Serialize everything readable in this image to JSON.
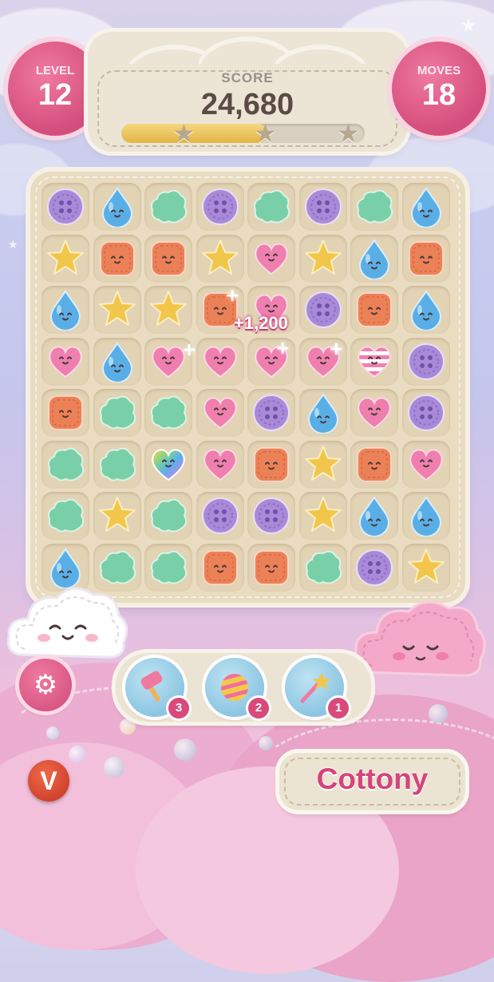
{
  "hud": {
    "level_label": "LEVEL",
    "level_value": "12",
    "score_label": "SCORE",
    "score_value": "24,680",
    "moves_label": "MOVES",
    "moves_value": "18",
    "score_progress": 0.6,
    "stars_total": 3
  },
  "board": {
    "rows": 8,
    "cols": 8,
    "grid": [
      [
        "button",
        "drop",
        "cloud",
        "button",
        "cloud",
        "button",
        "cloud",
        "drop"
      ],
      [
        "star",
        "square",
        "square",
        "star",
        "heart",
        "star",
        "drop",
        "square"
      ],
      [
        "drop",
        "star",
        "star",
        "square",
        "heart",
        "button",
        "square",
        "drop"
      ],
      [
        "heart",
        "drop",
        "heart",
        "heart",
        "heart",
        "heart",
        "striped-heart",
        "button"
      ],
      [
        "square",
        "cloud",
        "cloud",
        "heart",
        "button",
        "drop",
        "heart",
        "button"
      ],
      [
        "cloud",
        "cloud",
        "rainbow-heart",
        "heart",
        "square",
        "star",
        "square",
        "heart"
      ],
      [
        "cloud",
        "star",
        "cloud",
        "button",
        "button",
        "star",
        "drop",
        "drop"
      ],
      [
        "drop",
        "cloud",
        "cloud",
        "square",
        "square",
        "cloud",
        "button",
        "star"
      ]
    ],
    "score_popup": "+1,200"
  },
  "boosters": [
    {
      "name": "hammer",
      "count": "3"
    },
    {
      "name": "candy-ball",
      "count": "2"
    },
    {
      "name": "magic-wand",
      "count": "1"
    }
  ],
  "brand": {
    "name": "Cottony",
    "logo_letter": "V"
  },
  "colors": {
    "button": "#a88ad8",
    "drop": "#5aaee6",
    "cloud": "#79cfa8",
    "star": "#f2c64a",
    "square": "#ec8157",
    "heart": "#ef7fae",
    "accent": "#d94a7a"
  }
}
